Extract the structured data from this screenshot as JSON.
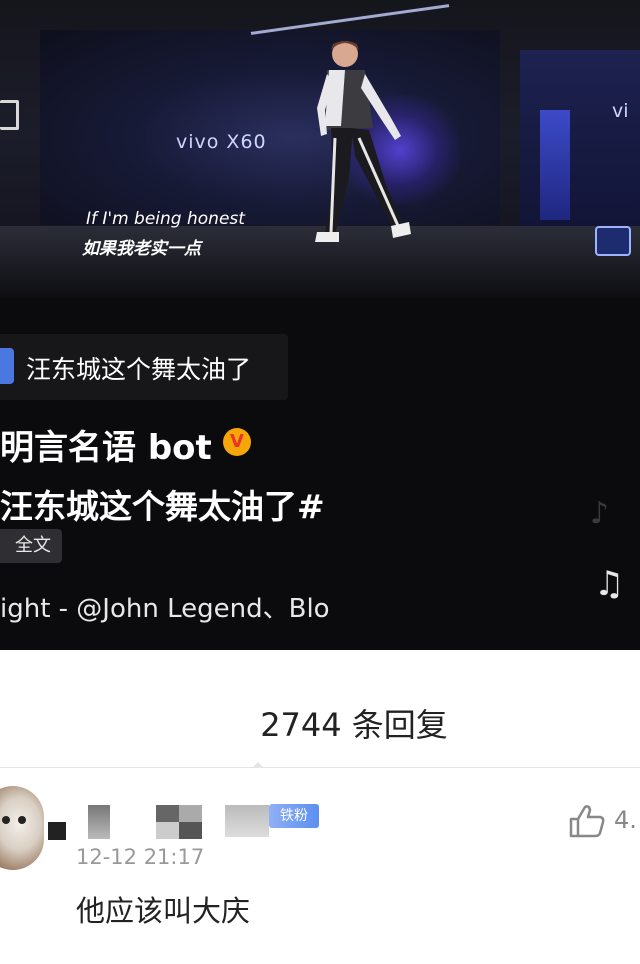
{
  "video": {
    "brand": "vivo X60",
    "brand_right": "vi",
    "subtitle_en": "If I'm being honest",
    "subtitle_zh": "如果我老实一点"
  },
  "post": {
    "topic_chip": "汪东城这个舞太油了",
    "author": "明言名语 bot",
    "verified_mark": "V",
    "text": "汪东城这个舞太油了#",
    "fulltext_button": "全文",
    "music": "ight - @John Legend、Blo"
  },
  "comments": {
    "reply_count": "2744 条回复",
    "first": {
      "badge": "铁粉",
      "time": "12-12 21:17",
      "text": "他应该叫大庆",
      "like_count": "4."
    }
  },
  "icons": {
    "music_note": "music-note-icon",
    "like": "thumbs-up-icon",
    "verified": "verified-badge-icon"
  },
  "colors": {
    "dark_bg": "#0b0b0d",
    "topic_accent": "#4a77e0",
    "verified_bg": "#f6a609",
    "badge_blue": "#5b8ff0"
  }
}
